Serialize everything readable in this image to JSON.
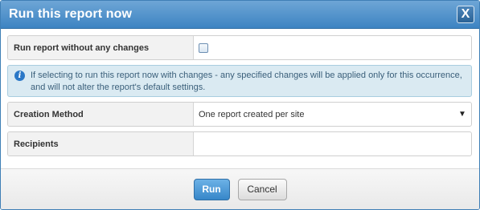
{
  "dialog": {
    "title": "Run this report now",
    "close_label": "X"
  },
  "form": {
    "run_without_changes": {
      "label": "Run report without any changes",
      "checked": false
    },
    "info_message": "If selecting to run this report now with changes - any specified changes will be applied only for this occurrence, and will not alter the report's default settings.",
    "creation_method": {
      "label": "Creation Method",
      "selected": "One report created per site",
      "caret": "▼"
    },
    "recipients": {
      "label": "Recipients",
      "value": ""
    }
  },
  "buttons": {
    "run_label": "Run",
    "cancel_label": "Cancel"
  },
  "icons": {
    "info": "i"
  },
  "colors": {
    "titlebar": "#4a8fca",
    "primary_button": "#3787c9",
    "info_background": "#daeaf2"
  }
}
